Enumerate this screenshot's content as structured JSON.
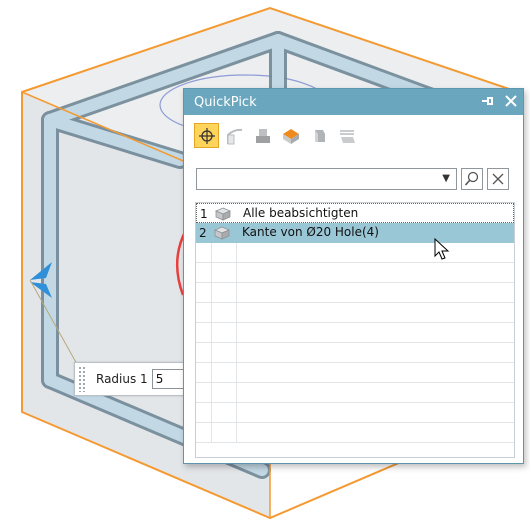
{
  "canvas": {
    "radius_label": "Radius 1",
    "radius_value": "5"
  },
  "quickpick": {
    "title": "QuickPick",
    "pin_icon": "pin-icon",
    "close_icon": "close-icon",
    "toolbar_icons": [
      "crosshair-icon",
      "curve-icon",
      "body-icon",
      "face-icon",
      "feature-icon",
      "pattern-icon"
    ],
    "filter_value": "",
    "rows": [
      {
        "num": "1",
        "label": "Alle beabsichtigten",
        "icon": "solid-icon"
      },
      {
        "num": "2",
        "label": "Kante von Ø20 Hole(4)",
        "icon": "solid-icon"
      }
    ]
  },
  "colors": {
    "titlebar": "#6aa7bf",
    "highlight_orange": "#f49a32",
    "selection": "#9ac7d6"
  }
}
